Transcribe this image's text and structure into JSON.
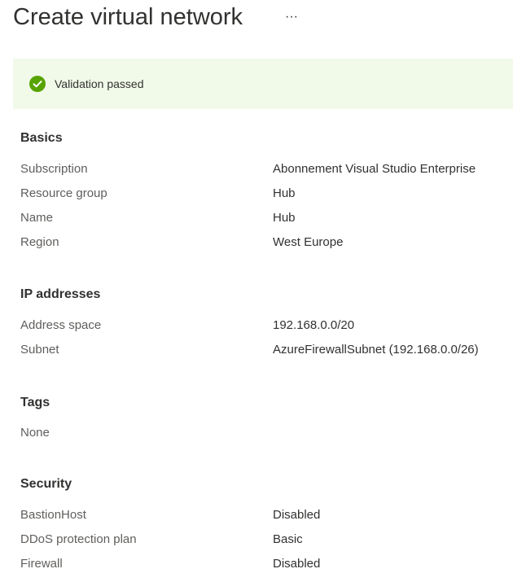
{
  "header": {
    "title": "Create virtual network",
    "more_label": "···"
  },
  "validation": {
    "text": "Validation passed",
    "icon": "check-circle-icon",
    "status_color": "#57a300",
    "background": "#f1fae9"
  },
  "sections": {
    "basics": {
      "title": "Basics",
      "rows": [
        {
          "label": "Subscription",
          "value": "Abonnement Visual Studio Enterprise"
        },
        {
          "label": "Resource group",
          "value": "Hub"
        },
        {
          "label": "Name",
          "value": "Hub"
        },
        {
          "label": "Region",
          "value": "West Europe"
        }
      ]
    },
    "ip": {
      "title": "IP addresses",
      "rows": [
        {
          "label": "Address space",
          "value": "192.168.0.0/20"
        },
        {
          "label": "Subnet",
          "value": "AzureFirewallSubnet (192.168.0.0/26)"
        }
      ]
    },
    "tags": {
      "title": "Tags",
      "rows": [
        {
          "label": "None",
          "value": ""
        }
      ]
    },
    "security": {
      "title": "Security",
      "rows": [
        {
          "label": "BastionHost",
          "value": "Disabled"
        },
        {
          "label": "DDoS protection plan",
          "value": "Basic"
        },
        {
          "label": "Firewall",
          "value": "Disabled"
        }
      ]
    }
  }
}
